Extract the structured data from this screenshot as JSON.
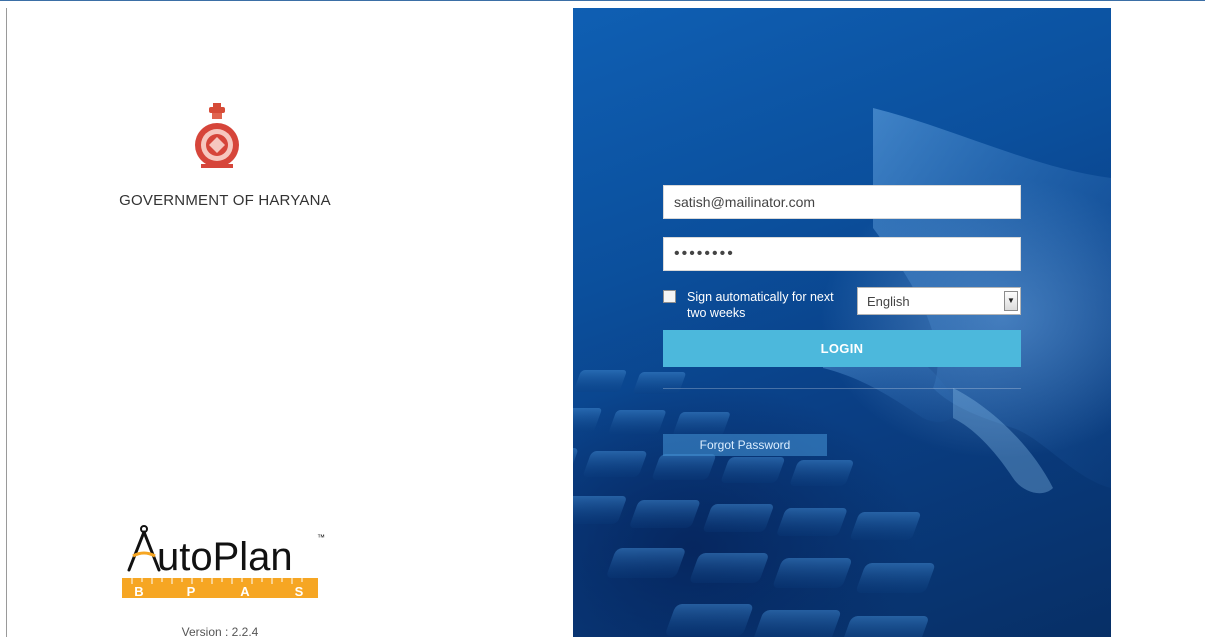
{
  "left_panel": {
    "government_title": "GOVERNMENT OF HARYANA",
    "logo": {
      "name": "AutoPlan",
      "trademark": "™",
      "letters": [
        "B",
        "P",
        "A",
        "S"
      ]
    },
    "version": "Version : 2.2.4"
  },
  "login_form": {
    "email_value": "satish@mailinator.com",
    "password_masked": "••••••••",
    "remember_label": "Sign automatically for next two weeks",
    "remember_checked": false,
    "language": {
      "selected": "English"
    },
    "login_label": "LOGIN",
    "forgot_label": "Forgot Password"
  },
  "colors": {
    "login_button": "#4cb8dc",
    "hero_blue": "#0b4f9c",
    "logo_orange": "#f6a623"
  },
  "icons": {
    "emblem": "state-emblem-icon",
    "dropdown": "chevron-down-icon"
  }
}
